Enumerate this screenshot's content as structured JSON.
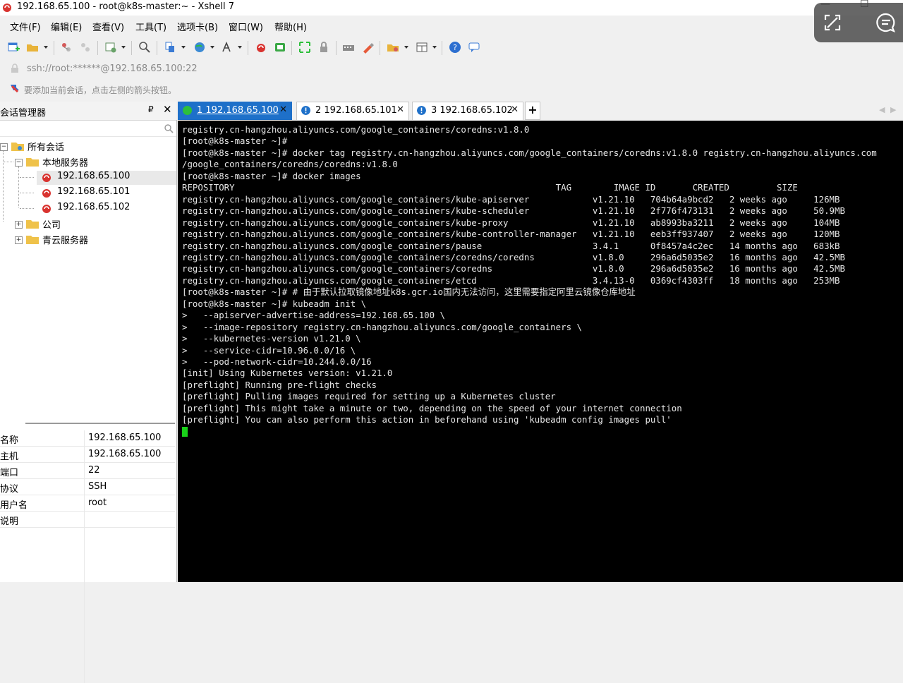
{
  "window": {
    "title": "192.168.65.100 - root@k8s-master:~ - Xshell 7",
    "controls": [
      "—",
      "☐"
    ]
  },
  "menu": [
    "文件(F)",
    "编辑(E)",
    "查看(V)",
    "工具(T)",
    "选项卡(B)",
    "窗口(W)",
    "帮助(H)"
  ],
  "toolbar": {
    "icons": [
      "new-session-icon",
      "open-folder-icon",
      "reconnect-icon",
      "disconnect-icon",
      "properties-icon",
      "find-icon",
      "transfer-icon",
      "globe-icon",
      "font-icon",
      "xshell-icon",
      "xftp-icon",
      "fullscreen-icon",
      "lock-icon",
      "keyboard-icon",
      "highlight-icon",
      "script-icon",
      "layout-icon",
      "help-icon",
      "chat-icon"
    ]
  },
  "address": {
    "text": "ssh://root:******@192.168.65.100:22"
  },
  "hint": {
    "text": "要添加当前会话，点击左侧的箭头按钮。"
  },
  "sidebar": {
    "title": "会话管理器",
    "pin": "₽",
    "close": "✕",
    "tree": {
      "root": "所有会话",
      "local_group": "本地服务器",
      "sessions": [
        "192.168.65.100",
        "192.168.65.101",
        "192.168.65.102"
      ],
      "company_group": "公司",
      "qingyun_group": "青云服务器"
    },
    "properties": [
      {
        "key": "名称",
        "value": "192.168.65.100"
      },
      {
        "key": "主机",
        "value": "192.168.65.100"
      },
      {
        "key": "端口",
        "value": "22"
      },
      {
        "key": "协议",
        "value": "SSH"
      },
      {
        "key": "用户名",
        "value": "root"
      },
      {
        "key": "说明",
        "value": ""
      }
    ]
  },
  "tabs": [
    {
      "label": "1 192.168.65.100",
      "active": true,
      "status": "connected"
    },
    {
      "label": "2 192.168.65.101",
      "active": false,
      "status": "warning"
    },
    {
      "label": "3 192.168.65.102",
      "active": false,
      "status": "warning"
    }
  ],
  "tab_close": "✕",
  "tab_add": "+",
  "terminal": {
    "lines": [
      "registry.cn-hangzhou.aliyuncs.com/google_containers/coredns:v1.8.0",
      "[root@k8s-master ~]#",
      "[root@k8s-master ~]# docker tag registry.cn-hangzhou.aliyuncs.com/google_containers/coredns:v1.8.0 registry.cn-hangzhou.aliyuncs.com",
      "/google_containers/coredns/coredns:v1.8.0",
      "[root@k8s-master ~]# docker images",
      "REPOSITORY                                                             TAG        IMAGE ID       CREATED         SIZE",
      "registry.cn-hangzhou.aliyuncs.com/google_containers/kube-apiserver            v1.21.10   704b64a9bcd2   2 weeks ago     126MB",
      "registry.cn-hangzhou.aliyuncs.com/google_containers/kube-scheduler            v1.21.10   2f776f473131   2 weeks ago     50.9MB",
      "registry.cn-hangzhou.aliyuncs.com/google_containers/kube-proxy                v1.21.10   ab8993ba3211   2 weeks ago     104MB",
      "registry.cn-hangzhou.aliyuncs.com/google_containers/kube-controller-manager   v1.21.10   eeb3ff937407   2 weeks ago     120MB",
      "registry.cn-hangzhou.aliyuncs.com/google_containers/pause                     3.4.1      0f8457a4c2ec   14 months ago   683kB",
      "registry.cn-hangzhou.aliyuncs.com/google_containers/coredns/coredns           v1.8.0     296a6d5035e2   16 months ago   42.5MB",
      "registry.cn-hangzhou.aliyuncs.com/google_containers/coredns                   v1.8.0     296a6d5035e2   16 months ago   42.5MB",
      "registry.cn-hangzhou.aliyuncs.com/google_containers/etcd                      3.4.13-0   0369cf4303ff   18 months ago   253MB",
      "[root@k8s-master ~]# # 由于默认拉取镜像地址k8s.gcr.io国内无法访问，这里需要指定阿里云镜像仓库地址",
      "[root@k8s-master ~]# kubeadm init \\",
      ">   --apiserver-advertise-address=192.168.65.100 \\",
      ">   --image-repository registry.cn-hangzhou.aliyuncs.com/google_containers \\",
      ">   --kubernetes-version v1.21.0 \\",
      ">   --service-cidr=10.96.0.0/16 \\",
      ">   --pod-network-cidr=10.244.0.0/16",
      "[init] Using Kubernetes version: v1.21.0",
      "[preflight] Running pre-flight checks",
      "[preflight] Pulling images required for setting up a Kubernetes cluster",
      "[preflight] This might take a minute or two, depending on the speed of your internet connection",
      "[preflight] You can also perform this action in beforehand using 'kubeadm config images pull'"
    ]
  },
  "colors": {
    "tab_active": "#1e70c9",
    "terminal_bg": "#000000",
    "terminal_fg": "#e6e6e6",
    "cursor": "#19d219",
    "connected": "#2dbf3b",
    "warning": "#1e70c9"
  }
}
